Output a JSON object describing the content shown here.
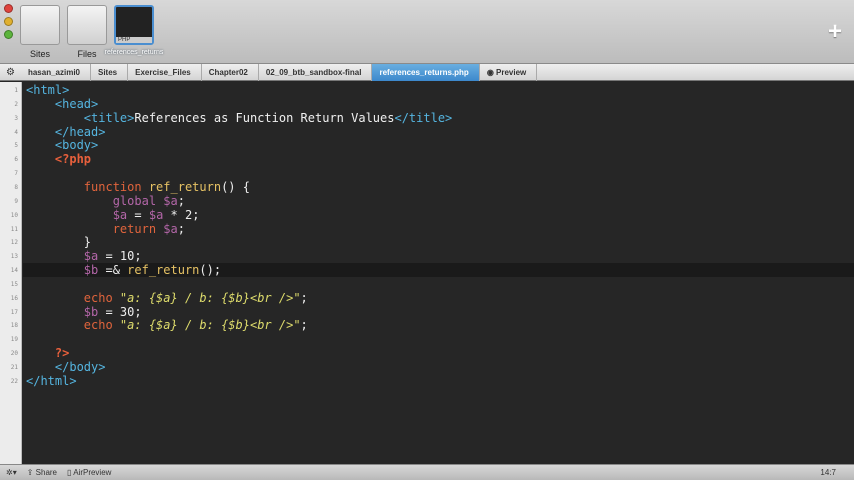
{
  "tabs": [
    {
      "label": "Sites"
    },
    {
      "label": "Files"
    },
    {
      "label": "references_returns",
      "badge": "PHP"
    }
  ],
  "breadcrumb": [
    "hasan_azimi0",
    "Sites",
    "Exercise_Files",
    "Chapter02",
    "02_09_btb_sandbox-final",
    "references_returns.php",
    "Preview"
  ],
  "status": {
    "share": "Share",
    "airpreview": "AirPreview",
    "position": "14:7"
  },
  "code": {
    "current_line": 14,
    "lines": [
      [
        [
          "tag",
          "<html>"
        ]
      ],
      [
        [
          "txt",
          "    "
        ],
        [
          "tag",
          "<head>"
        ]
      ],
      [
        [
          "txt",
          "        "
        ],
        [
          "tag",
          "<title>"
        ],
        [
          "txt",
          "References as Function Return Values"
        ],
        [
          "tag",
          "</title>"
        ]
      ],
      [
        [
          "txt",
          "    "
        ],
        [
          "tag",
          "</head>"
        ]
      ],
      [
        [
          "txt",
          "    "
        ],
        [
          "tag",
          "<body>"
        ]
      ],
      [
        [
          "txt",
          "    "
        ],
        [
          "php",
          "<?php"
        ]
      ],
      [],
      [
        [
          "txt",
          "        "
        ],
        [
          "kw",
          "function "
        ],
        [
          "fn",
          "ref_return"
        ],
        [
          "op",
          "() {"
        ]
      ],
      [
        [
          "txt",
          "            "
        ],
        [
          "var",
          "global $a"
        ],
        [
          "op",
          ";"
        ]
      ],
      [
        [
          "txt",
          "            "
        ],
        [
          "var",
          "$a"
        ],
        [
          "op",
          " = "
        ],
        [
          "var",
          "$a"
        ],
        [
          "op",
          " * 2;"
        ]
      ],
      [
        [
          "txt",
          "            "
        ],
        [
          "kw",
          "return "
        ],
        [
          "var",
          "$a"
        ],
        [
          "op",
          ";"
        ]
      ],
      [
        [
          "txt",
          "        "
        ],
        [
          "op",
          "}"
        ]
      ],
      [
        [
          "txt",
          "        "
        ],
        [
          "var",
          "$a"
        ],
        [
          "op",
          " = 10;"
        ]
      ],
      [
        [
          "txt",
          "        "
        ],
        [
          "var",
          "$b"
        ],
        [
          "op",
          " =& "
        ],
        [
          "fn",
          "ref_return"
        ],
        [
          "op",
          "();"
        ]
      ],
      [],
      [
        [
          "txt",
          "        "
        ],
        [
          "kw",
          "echo "
        ],
        [
          "str",
          "\"a: {$a} / b: {$b}<br />\""
        ],
        [
          "op",
          ";"
        ]
      ],
      [
        [
          "txt",
          "        "
        ],
        [
          "var",
          "$b"
        ],
        [
          "op",
          " = 30;"
        ]
      ],
      [
        [
          "txt",
          "        "
        ],
        [
          "kw",
          "echo "
        ],
        [
          "str",
          "\"a: {$a} / b: {$b}<br />\""
        ],
        [
          "op",
          ";"
        ]
      ],
      [],
      [
        [
          "txt",
          "    "
        ],
        [
          "php",
          "?>"
        ]
      ],
      [
        [
          "txt",
          "    "
        ],
        [
          "tag",
          "</body>"
        ]
      ],
      [
        [
          "tag",
          "</html>"
        ]
      ]
    ]
  }
}
